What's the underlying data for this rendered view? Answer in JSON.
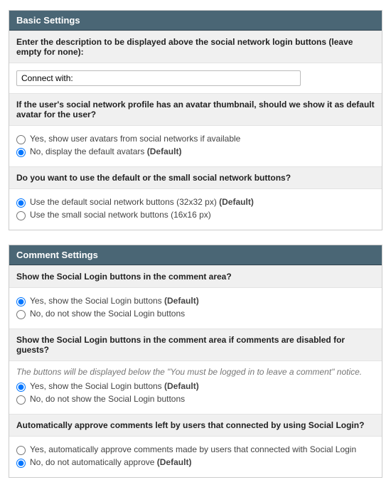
{
  "basic": {
    "header": "Basic Settings",
    "q1": {
      "label": "Enter the description to be displayed above the social network login buttons (leave empty for none):",
      "value": "Connect with:"
    },
    "q2": {
      "label": "If the user's social network profile has an avatar thumbnail, should we show it as default avatar for the user?",
      "opt_yes": "Yes, show user avatars from social networks if available",
      "opt_no": "No, display the default avatars",
      "default_tag": " (Default)"
    },
    "q3": {
      "label": "Do you want to use the default or the small social network buttons?",
      "opt_default": "Use the default social network buttons (32x32 px)",
      "opt_small": "Use the small social network buttons (16x16 px)",
      "default_tag": " (Default)"
    }
  },
  "comment": {
    "header": "Comment Settings",
    "q1": {
      "label": "Show the Social Login buttons in the comment area?",
      "opt_yes": "Yes, show the Social Login buttons",
      "opt_no": "No, do not show the Social Login buttons",
      "default_tag": " (Default)"
    },
    "q2": {
      "label": "Show the Social Login buttons in the comment area if comments are disabled for guests?",
      "hint": "The buttons will be displayed below the \"You must be logged in to leave a comment\" notice.",
      "opt_yes": "Yes, show the Social Login buttons",
      "opt_no": "No, do not show the Social Login buttons",
      "default_tag": " (Default)"
    },
    "q3": {
      "label": "Automatically approve comments left by users that connected by using Social Login?",
      "opt_yes": "Yes, automatically approve comments made by users that connected with Social Login",
      "opt_no": "No, do not automatically approve",
      "default_tag": " (Default)"
    }
  }
}
